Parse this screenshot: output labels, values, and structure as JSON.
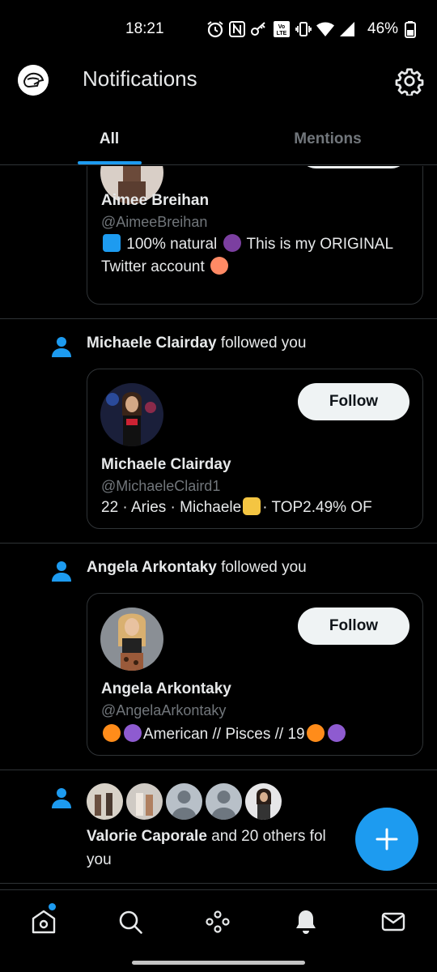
{
  "status_bar": {
    "time": "18:21",
    "battery": "46%"
  },
  "header": {
    "title": "Notifications"
  },
  "tabs": [
    {
      "label": "All"
    },
    {
      "label": "Mentions"
    }
  ],
  "notifications": [
    {
      "name": "Aimee Breihan",
      "handle": "@AimeeBreihan",
      "bio_part1": "100% natural",
      "bio_part2": "This is my ORIGINAL Twitter account"
    },
    {
      "actor": "Michaele Clairday",
      "action": "followed you",
      "name": "Michaele Clairday",
      "handle": "@MichaeleClaird1",
      "bio_part1": "22 · Aries · Michaele",
      "bio_part2": "· TOP2.49% OF",
      "follow_label": "Follow"
    },
    {
      "actor": "Angela Arkontaky",
      "action": "followed you",
      "name": "Angela Arkontaky",
      "handle": "@AngelaArkontaky",
      "bio_part1": "American // Pisces // 19",
      "follow_label": "Follow"
    },
    {
      "actor": "Valorie Caporale",
      "action": "and 20 others fol",
      "action_line2": "you"
    }
  ],
  "colors": {
    "accent": "#1d9bf0",
    "background": "#000000",
    "muted": "#71767b",
    "border": "#2f3336"
  },
  "bottom_nav": [
    "home-icon",
    "search-icon",
    "spaces-icon",
    "bell-icon",
    "mail-icon"
  ]
}
